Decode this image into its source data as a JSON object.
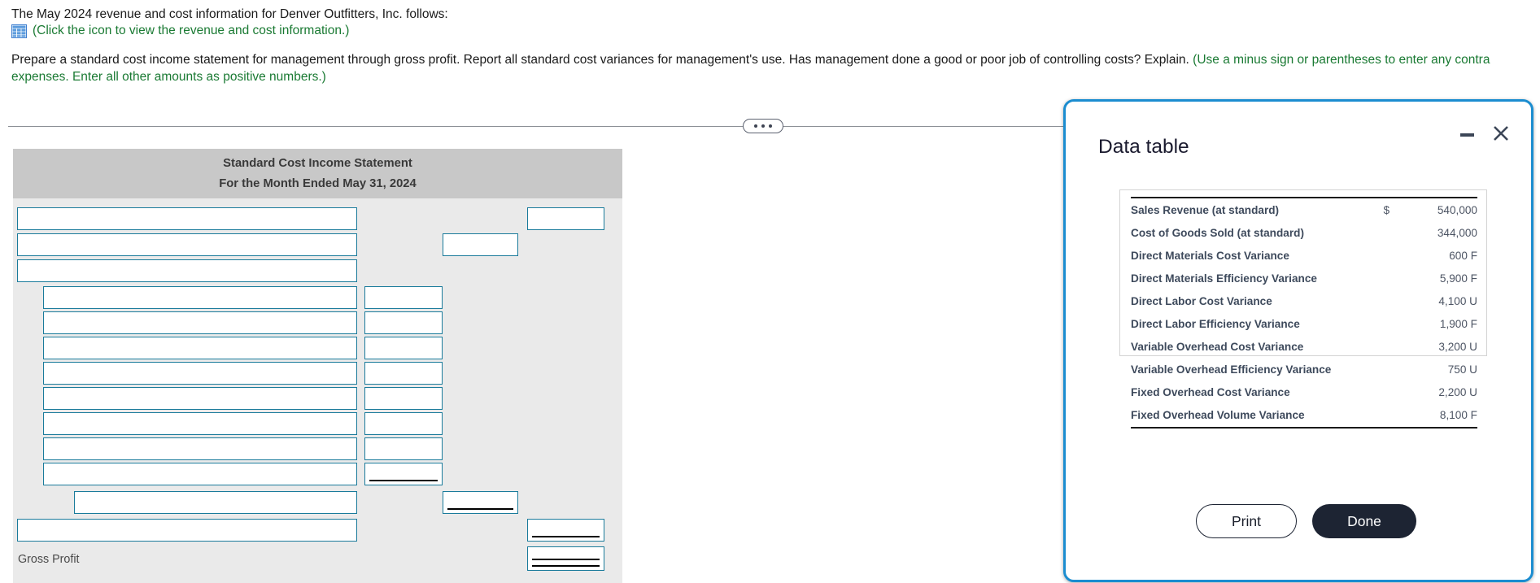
{
  "problem": {
    "line1": "The May 2024 revenue and cost information for Denver Outfitters, Inc. follows:",
    "icon_link": "(Click the icon to view the revenue and cost information.)",
    "icon_name": "spreadsheet-icon",
    "instructions_black": "Prepare a standard cost income statement for management through gross profit. Report all standard cost variances for management's use. Has management done a good or poor job of controlling costs? Explain. ",
    "instructions_green": "(Use a minus sign or parentheses to enter any contra expenses. Enter all other amounts as positive numbers.)"
  },
  "divider": {
    "dots": "•••"
  },
  "worksheet": {
    "title": "Standard Cost Income Statement",
    "subtitle": "For the Month Ended May 31, 2024",
    "gross_profit_label": "Gross Profit",
    "rows": [
      {
        "label_value": "",
        "amount_value": "",
        "total_value": ""
      }
    ],
    "input_values": {
      "r1_label": "",
      "r1_total": "",
      "r2_label": "",
      "r2_amount": "",
      "r3_label": "",
      "v1_label": "",
      "v1_amount": "",
      "v2_label": "",
      "v2_amount": "",
      "v3_label": "",
      "v3_amount": "",
      "v4_label": "",
      "v4_amount": "",
      "v5_label": "",
      "v5_amount": "",
      "v6_label": "",
      "v6_amount": "",
      "v7_label": "",
      "v7_amount": "",
      "v8_label": "",
      "v8_amount": "",
      "sub_label": "",
      "sub_amount": "",
      "last_label": "",
      "last_total": "",
      "gross_total": ""
    }
  },
  "modal": {
    "title": "Data table",
    "minimize_icon": "minimize-icon",
    "close_icon": "close-icon",
    "print_label": "Print",
    "done_label": "Done",
    "table": {
      "rows": [
        {
          "label": "Sales Revenue (at standard)",
          "currency": "$",
          "value": "540,000"
        },
        {
          "label": "Cost of Goods Sold (at standard)",
          "currency": "",
          "value": "344,000"
        },
        {
          "label": "Direct Materials Cost Variance",
          "currency": "",
          "value": "600 F"
        },
        {
          "label": "Direct Materials Efficiency Variance",
          "currency": "",
          "value": "5,900 F"
        },
        {
          "label": "Direct Labor Cost Variance",
          "currency": "",
          "value": "4,100 U"
        },
        {
          "label": "Direct Labor Efficiency Variance",
          "currency": "",
          "value": "1,900 F"
        },
        {
          "label": "Variable Overhead Cost Variance",
          "currency": "",
          "value": "3,200 U"
        },
        {
          "label": "Variable Overhead Efficiency Variance",
          "currency": "",
          "value": "750 U"
        },
        {
          "label": "Fixed Overhead Cost Variance",
          "currency": "",
          "value": "2,200 U"
        },
        {
          "label": "Fixed Overhead Volume Variance",
          "currency": "",
          "value": "8,100 F"
        }
      ]
    }
  },
  "colors": {
    "accent_border": "#1b8dd0",
    "input_border": "#1a7b9b",
    "link_green": "#1a7a33",
    "sheet_bg": "#eaeaea",
    "sheet_header_bg": "#c8c8c8",
    "done_bg": "#1d2433"
  }
}
